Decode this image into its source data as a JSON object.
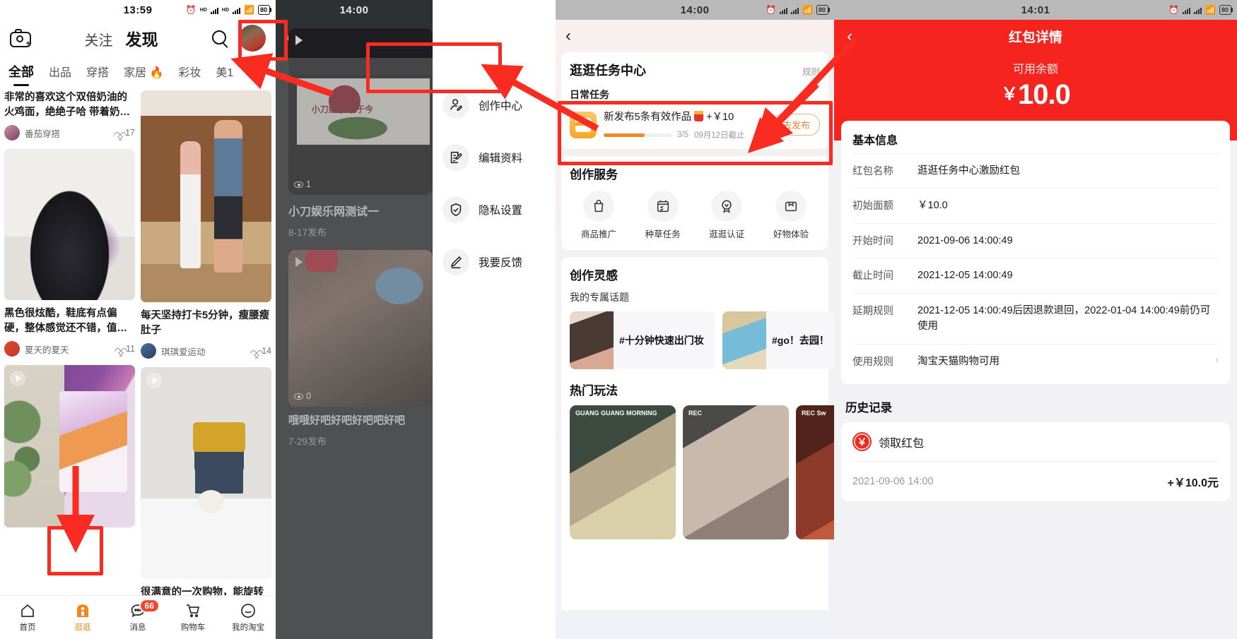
{
  "panel1": {
    "status": {
      "time": "13:59",
      "battery": "80",
      "net1": "HD",
      "net2": "HD"
    },
    "header": {
      "camera_icon": "camera-plus-icon",
      "tab_follow": "关注",
      "tab_discover": "发现",
      "search_icon": "search-icon",
      "avatar": "user-avatar"
    },
    "categories": [
      {
        "label": "全部",
        "active": true
      },
      {
        "label": "出品",
        "active": false
      },
      {
        "label": "穿搭",
        "active": false
      },
      {
        "label": "家居 🔥",
        "active": false
      },
      {
        "label": "彩妆",
        "active": false
      },
      {
        "label": "美1",
        "active": false
      }
    ],
    "add_category": "+",
    "cards": [
      {
        "title": "非常的喜欢这个双倍奶油的火鸡面，绝绝子哈 带着奶…",
        "author": "番茄穿搭",
        "likes": "17"
      },
      {
        "title": "黑色很炫酷，鞋底有点偏硬，整体感觉还不错，值…",
        "author": "夏天的夏天",
        "likes": "11"
      },
      {
        "title": "每天坚持打卡5分钟，瘦腰瘦肚子",
        "author": "琪琪爱运动",
        "likes": "14"
      },
      {
        "title": "很满意的一次购物，能旋转不占地方，怎么放都合适…",
        "author": "",
        "likes": ""
      }
    ],
    "tabbar": [
      {
        "label": "首页",
        "icon": "home-icon",
        "active": false,
        "badge": ""
      },
      {
        "label": "逛逛",
        "icon": "stroll-icon",
        "active": true,
        "badge": ""
      },
      {
        "label": "消息",
        "icon": "message-icon",
        "active": false,
        "badge": "66"
      },
      {
        "label": "购物车",
        "icon": "cart-icon",
        "active": false,
        "badge": ""
      },
      {
        "label": "我的淘宝",
        "icon": "profile-icon",
        "active": false,
        "badge": ""
      }
    ]
  },
  "panel2": {
    "status": {
      "time": "14:00"
    },
    "back_icon": "chevron-left-icon",
    "video": {
      "views": "1",
      "caption": "小刀娱乐网测试一",
      "date": "8-17发布"
    },
    "video2": {
      "views": "0",
      "caption": "哦哦好吧好吧好吧吧好吧",
      "date": "7-29发布"
    },
    "menu": [
      {
        "label": "创作中心",
        "icon": "creator-center-icon"
      },
      {
        "label": "编辑资料",
        "icon": "edit-profile-icon"
      },
      {
        "label": "隐私设置",
        "icon": "privacy-shield-icon"
      },
      {
        "label": "我要反馈",
        "icon": "feedback-pen-icon"
      }
    ]
  },
  "panel3": {
    "status": {
      "time": "14:00",
      "battery": "80"
    },
    "back_icon": "chevron-left-icon",
    "task_center": {
      "title": "逛逛任务中心",
      "rules_link": "规则",
      "section": "日常任务",
      "task_name": "新发布5条有效作品",
      "task_reward": "+￥10",
      "progress_text": "3/5",
      "deadline": "09月12日截止",
      "progress_percent": 60,
      "go_button": "去发布"
    },
    "services": {
      "title": "创作服务",
      "items": [
        {
          "label": "商品推广",
          "icon": "bag-icon"
        },
        {
          "label": "种草任务",
          "icon": "calendar-check-icon"
        },
        {
          "label": "逛逛认证",
          "icon": "badge-check-icon"
        },
        {
          "label": "好物体验",
          "icon": "box-icon"
        }
      ]
    },
    "inspiration": {
      "title": "创作灵感",
      "subtitle": "我的专属话题",
      "topics": [
        {
          "label": "#十分钟快速出门妆"
        },
        {
          "label": "#go！去园！"
        }
      ],
      "hot_title": "热门玩法",
      "cards": [
        {
          "label": "GUANG GUANG MORNING"
        },
        {
          "label": "REC"
        },
        {
          "label": "REC Sw"
        }
      ]
    }
  },
  "panel4": {
    "status": {
      "time": "14:01",
      "battery": "80"
    },
    "back_icon": "chevron-left-icon",
    "title": "红包详情",
    "balance_label": "可用余额",
    "balance_currency": "￥",
    "balance_amount": "10.0",
    "basic_info": {
      "heading": "基本信息",
      "rows": [
        {
          "key": "红包名称",
          "value": "逛逛任务中心激励红包",
          "arrow": false
        },
        {
          "key": "初始面额",
          "value": "￥10.0",
          "arrow": false
        },
        {
          "key": "开始时间",
          "value": "2021-09-06 14:00:49",
          "arrow": false
        },
        {
          "key": "截止时间",
          "value": "2021-12-05 14:00:49",
          "arrow": false
        },
        {
          "key": "延期规则",
          "value": "2021-12-05 14:00:49后因退款退回，2022-01-04 14:00:49前仍可使用",
          "arrow": false
        },
        {
          "key": "使用规则",
          "value": "淘宝天猫购物可用",
          "arrow": true
        }
      ]
    },
    "history": {
      "heading": "历史记录",
      "entry_label": "领取红包",
      "entry_icon": "red-packet-coin-icon",
      "rows": [
        {
          "date": "2021-09-06 14:00",
          "amount": "+￥10.0元"
        }
      ]
    }
  },
  "annotations": {
    "colors": {
      "marker": "#fa2b20"
    },
    "boxes": [
      {
        "name": "avatar-highlight"
      },
      {
        "name": "creator-center-highlight"
      },
      {
        "name": "daily-task-highlight"
      },
      {
        "name": "stroll-tab-highlight"
      }
    ]
  }
}
